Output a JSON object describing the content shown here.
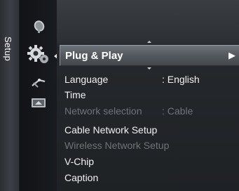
{
  "side_tab": {
    "label": "Setup"
  },
  "categories": [
    {
      "icon": "satellite-dish-icon",
      "active": false
    },
    {
      "icon": "gear-icon",
      "active": true
    },
    {
      "icon": "antenna-icon",
      "active": false
    },
    {
      "icon": "input-source-icon",
      "active": false
    }
  ],
  "menu": {
    "highlighted": {
      "label": "Plug & Play",
      "arrow": "▶"
    },
    "items": [
      {
        "label": "Language",
        "value": ": English",
        "enabled": true
      },
      {
        "label": "Time",
        "value": "",
        "enabled": true
      },
      {
        "label": "Network selection",
        "value": ": Cable",
        "enabled": false
      },
      {
        "label": "Cable Network Setup",
        "value": "",
        "enabled": true
      },
      {
        "label": "Wireless Network Setup",
        "value": "",
        "enabled": false
      },
      {
        "label": "V-Chip",
        "value": "",
        "enabled": true
      },
      {
        "label": "Caption",
        "value": "",
        "enabled": true
      }
    ]
  },
  "colors": {
    "text": "#f2f2f2",
    "disabled_text": "#6f7377",
    "highlight": "#5a5f65"
  }
}
